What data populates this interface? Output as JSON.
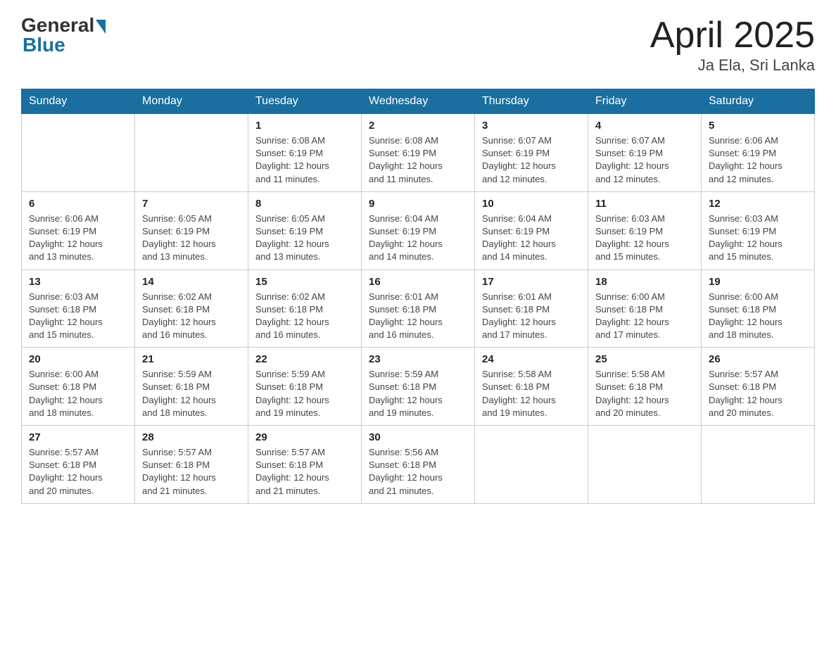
{
  "header": {
    "logo_general": "General",
    "logo_blue": "Blue",
    "title": "April 2025",
    "subtitle": "Ja Ela, Sri Lanka"
  },
  "days_of_week": [
    "Sunday",
    "Monday",
    "Tuesday",
    "Wednesday",
    "Thursday",
    "Friday",
    "Saturday"
  ],
  "weeks": [
    [
      {
        "day": "",
        "info": ""
      },
      {
        "day": "",
        "info": ""
      },
      {
        "day": "1",
        "info": "Sunrise: 6:08 AM\nSunset: 6:19 PM\nDaylight: 12 hours\nand 11 minutes."
      },
      {
        "day": "2",
        "info": "Sunrise: 6:08 AM\nSunset: 6:19 PM\nDaylight: 12 hours\nand 11 minutes."
      },
      {
        "day": "3",
        "info": "Sunrise: 6:07 AM\nSunset: 6:19 PM\nDaylight: 12 hours\nand 12 minutes."
      },
      {
        "day": "4",
        "info": "Sunrise: 6:07 AM\nSunset: 6:19 PM\nDaylight: 12 hours\nand 12 minutes."
      },
      {
        "day": "5",
        "info": "Sunrise: 6:06 AM\nSunset: 6:19 PM\nDaylight: 12 hours\nand 12 minutes."
      }
    ],
    [
      {
        "day": "6",
        "info": "Sunrise: 6:06 AM\nSunset: 6:19 PM\nDaylight: 12 hours\nand 13 minutes."
      },
      {
        "day": "7",
        "info": "Sunrise: 6:05 AM\nSunset: 6:19 PM\nDaylight: 12 hours\nand 13 minutes."
      },
      {
        "day": "8",
        "info": "Sunrise: 6:05 AM\nSunset: 6:19 PM\nDaylight: 12 hours\nand 13 minutes."
      },
      {
        "day": "9",
        "info": "Sunrise: 6:04 AM\nSunset: 6:19 PM\nDaylight: 12 hours\nand 14 minutes."
      },
      {
        "day": "10",
        "info": "Sunrise: 6:04 AM\nSunset: 6:19 PM\nDaylight: 12 hours\nand 14 minutes."
      },
      {
        "day": "11",
        "info": "Sunrise: 6:03 AM\nSunset: 6:19 PM\nDaylight: 12 hours\nand 15 minutes."
      },
      {
        "day": "12",
        "info": "Sunrise: 6:03 AM\nSunset: 6:19 PM\nDaylight: 12 hours\nand 15 minutes."
      }
    ],
    [
      {
        "day": "13",
        "info": "Sunrise: 6:03 AM\nSunset: 6:18 PM\nDaylight: 12 hours\nand 15 minutes."
      },
      {
        "day": "14",
        "info": "Sunrise: 6:02 AM\nSunset: 6:18 PM\nDaylight: 12 hours\nand 16 minutes."
      },
      {
        "day": "15",
        "info": "Sunrise: 6:02 AM\nSunset: 6:18 PM\nDaylight: 12 hours\nand 16 minutes."
      },
      {
        "day": "16",
        "info": "Sunrise: 6:01 AM\nSunset: 6:18 PM\nDaylight: 12 hours\nand 16 minutes."
      },
      {
        "day": "17",
        "info": "Sunrise: 6:01 AM\nSunset: 6:18 PM\nDaylight: 12 hours\nand 17 minutes."
      },
      {
        "day": "18",
        "info": "Sunrise: 6:00 AM\nSunset: 6:18 PM\nDaylight: 12 hours\nand 17 minutes."
      },
      {
        "day": "19",
        "info": "Sunrise: 6:00 AM\nSunset: 6:18 PM\nDaylight: 12 hours\nand 18 minutes."
      }
    ],
    [
      {
        "day": "20",
        "info": "Sunrise: 6:00 AM\nSunset: 6:18 PM\nDaylight: 12 hours\nand 18 minutes."
      },
      {
        "day": "21",
        "info": "Sunrise: 5:59 AM\nSunset: 6:18 PM\nDaylight: 12 hours\nand 18 minutes."
      },
      {
        "day": "22",
        "info": "Sunrise: 5:59 AM\nSunset: 6:18 PM\nDaylight: 12 hours\nand 19 minutes."
      },
      {
        "day": "23",
        "info": "Sunrise: 5:59 AM\nSunset: 6:18 PM\nDaylight: 12 hours\nand 19 minutes."
      },
      {
        "day": "24",
        "info": "Sunrise: 5:58 AM\nSunset: 6:18 PM\nDaylight: 12 hours\nand 19 minutes."
      },
      {
        "day": "25",
        "info": "Sunrise: 5:58 AM\nSunset: 6:18 PM\nDaylight: 12 hours\nand 20 minutes."
      },
      {
        "day": "26",
        "info": "Sunrise: 5:57 AM\nSunset: 6:18 PM\nDaylight: 12 hours\nand 20 minutes."
      }
    ],
    [
      {
        "day": "27",
        "info": "Sunrise: 5:57 AM\nSunset: 6:18 PM\nDaylight: 12 hours\nand 20 minutes."
      },
      {
        "day": "28",
        "info": "Sunrise: 5:57 AM\nSunset: 6:18 PM\nDaylight: 12 hours\nand 21 minutes."
      },
      {
        "day": "29",
        "info": "Sunrise: 5:57 AM\nSunset: 6:18 PM\nDaylight: 12 hours\nand 21 minutes."
      },
      {
        "day": "30",
        "info": "Sunrise: 5:56 AM\nSunset: 6:18 PM\nDaylight: 12 hours\nand 21 minutes."
      },
      {
        "day": "",
        "info": ""
      },
      {
        "day": "",
        "info": ""
      },
      {
        "day": "",
        "info": ""
      }
    ]
  ]
}
